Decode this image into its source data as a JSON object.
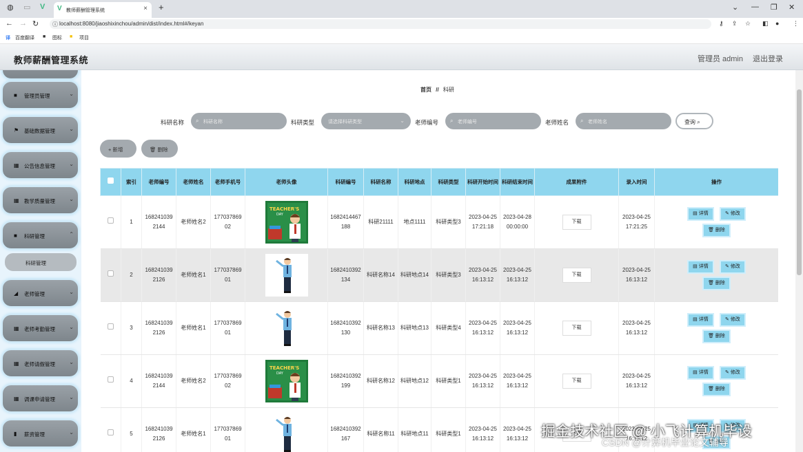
{
  "browser": {
    "tab_title": "教师薪酬管理系统",
    "url": "localhost:8080/jiaoshixinchou/admin/dist/index.html#/keyan",
    "bookmarks": [
      "百度翻译",
      "图标",
      "项目"
    ]
  },
  "header": {
    "title": "教师薪酬管理系统",
    "admin": "管理员 admin",
    "logout": "退出登录"
  },
  "sidebar": {
    "items": [
      {
        "icon": "■",
        "label": "管理员管理"
      },
      {
        "icon": "⚑",
        "label": "基础数据管理"
      },
      {
        "icon": "▦",
        "label": "公告信息管理"
      },
      {
        "icon": "▦",
        "label": "教学质量管理"
      },
      {
        "icon": "■",
        "label": "科研管理"
      },
      {
        "icon": "◢",
        "label": "老师管理"
      },
      {
        "icon": "▦",
        "label": "老师考勤管理"
      },
      {
        "icon": "▦",
        "label": "老师请假管理"
      },
      {
        "icon": "▦",
        "label": "调课申请管理"
      },
      {
        "icon": "▮",
        "label": "薪资管理"
      }
    ],
    "sub_item": "科研管理"
  },
  "breadcrumb": {
    "home": "首页",
    "sep": "//",
    "current": "科研"
  },
  "search": {
    "fields": [
      {
        "label": "科研名称",
        "placeholder": "科研名称"
      },
      {
        "label": "科研类型",
        "placeholder": "请选择科研类型"
      },
      {
        "label": "老师编号",
        "placeholder": "老师编号"
      },
      {
        "label": "老师姓名",
        "placeholder": "老师姓名"
      }
    ],
    "button": "查询"
  },
  "actions": {
    "add": "+ 新增",
    "delete": "删除"
  },
  "table": {
    "headers": [
      "索引",
      "老师编号",
      "老师姓名",
      "老师手机号",
      "老师头像",
      "科研编号",
      "科研名称",
      "科研地点",
      "科研类型",
      "科研开始时间",
      "科研结束时间",
      "成果附件",
      "录入时间",
      "操作"
    ],
    "download": "下载",
    "btn_detail": "详情",
    "btn_edit": "修改",
    "btn_delete": "删除",
    "rows": [
      {
        "idx": "1",
        "tno": "1682410392144",
        "tname": "老师姓名2",
        "phone": "17703786902",
        "avatar": "poster",
        "kno": "1682414467188",
        "kname": "科研21111",
        "place": "地点1111",
        "ktype": "科研类型3",
        "start": "2023-04-25 17:21:18",
        "end": "2023-04-28 00:00:00",
        "entry": "2023-04-25 17:21:25"
      },
      {
        "idx": "2",
        "tno": "1682410392126",
        "tname": "老师姓名1",
        "phone": "17703786901",
        "avatar": "teacher",
        "kno": "1682410392134",
        "kname": "科研名称14",
        "place": "科研地点14",
        "ktype": "科研类型3",
        "start": "2023-04-25 16:13:12",
        "end": "2023-04-25 16:13:12",
        "entry": "2023-04-25 16:13:12"
      },
      {
        "idx": "3",
        "tno": "1682410392126",
        "tname": "老师姓名1",
        "phone": "17703786901",
        "avatar": "teacher",
        "kno": "1682410392130",
        "kname": "科研名称13",
        "place": "科研地点13",
        "ktype": "科研类型4",
        "start": "2023-04-25 16:13:12",
        "end": "2023-04-25 16:13:12",
        "entry": "2023-04-25 16:13:12"
      },
      {
        "idx": "4",
        "tno": "1682410392144",
        "tname": "老师姓名2",
        "phone": "17703786902",
        "avatar": "poster",
        "kno": "1682410392199",
        "kname": "科研名称12",
        "place": "科研地点12",
        "ktype": "科研类型1",
        "start": "2023-04-25 16:13:12",
        "end": "2023-04-25 16:13:12",
        "entry": "2023-04-25 16:13:12"
      },
      {
        "idx": "5",
        "tno": "1682410392126",
        "tname": "老师姓名1",
        "phone": "17703786901",
        "avatar": "teacher",
        "kno": "1682410392167",
        "kname": "科研名称11",
        "place": "科研地点11",
        "ktype": "科研类型1",
        "start": "2023-04-25 16:13:12",
        "end": "2023-04-25 16:13:12",
        "entry": "2023-04-25 16:13:12"
      }
    ]
  },
  "watermark": {
    "line1": "掘金技术社区 @ 小飞计算机毕设",
    "line2": "CSDN @计算机毕业论文辅导"
  }
}
